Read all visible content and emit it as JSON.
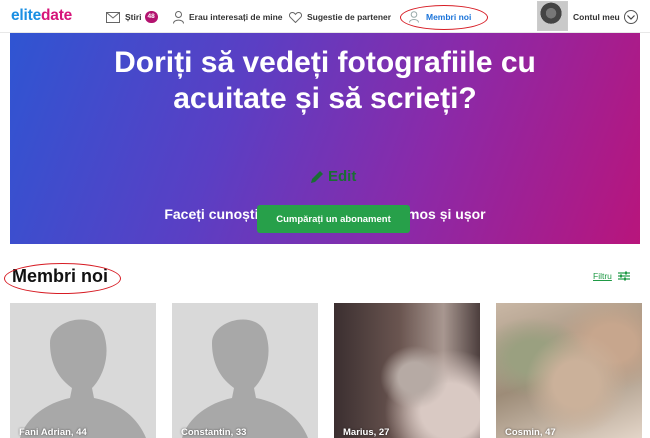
{
  "header": {
    "logo_part1": "elite",
    "logo_part2": "date",
    "nav": [
      {
        "label": "Știri",
        "badge": "48",
        "icon": "envelope-icon"
      },
      {
        "label": "Erau interesați de mine",
        "icon": "person-icon"
      },
      {
        "label": "Sugestie de partener",
        "icon": "heart-icon"
      },
      {
        "label": "Membri noi",
        "icon": "user-add-icon",
        "active": true
      }
    ],
    "account_label": "Contul meu"
  },
  "hero": {
    "title_line1": "Doriți să vedeți fotografiile cu",
    "title_line2": "acuitate și să scrieți?",
    "edit_label": "Edit",
    "subtitle": "Faceți cunoștință unul cu celălalt frumos și ușor",
    "cta_label": "Cumpărați un abonament"
  },
  "members": {
    "title": "Membri noi",
    "filter_label": "Filtru",
    "cards": [
      {
        "name": "Fani Adrian, 44",
        "photo": "placeholder"
      },
      {
        "name": "Constantin, 33",
        "photo": "placeholder"
      },
      {
        "name": "Marius, 27",
        "photo": "blurred"
      },
      {
        "name": "Cosmin, 47",
        "photo": "blurred"
      }
    ]
  },
  "colors": {
    "accent_green": "#27a04a",
    "brand_blue": "#1a8fe3",
    "brand_pink": "#d6157a",
    "annotation_red": "#d71c24"
  }
}
